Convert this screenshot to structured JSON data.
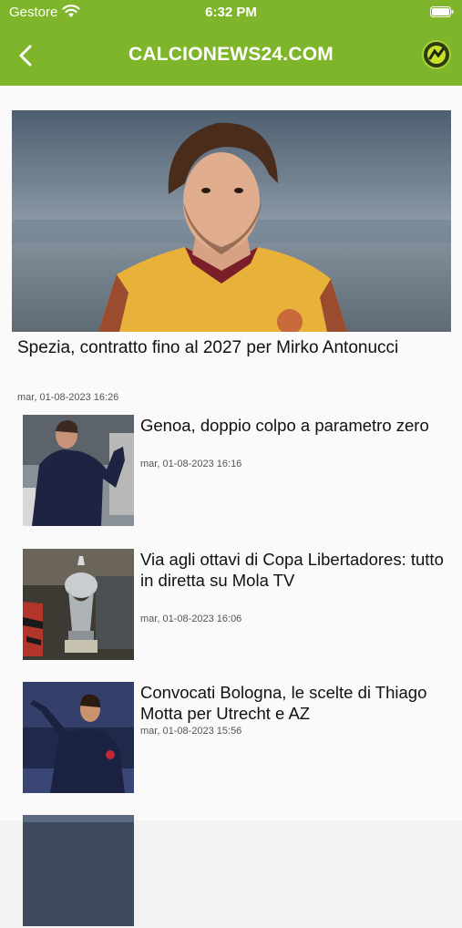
{
  "status_bar": {
    "carrier": "Gestore",
    "time": "6:32 PM"
  },
  "nav": {
    "title": "CALCIONEWS24.COM",
    "back_icon": "chevron-left-icon",
    "logo_icon": "site-logo-icon"
  },
  "colors": {
    "brand_green": "#7fb52a",
    "background": "#fafafa"
  },
  "hero": {
    "title": "Spezia, contratto fino al 2027 per Mirko Antonucci",
    "date": "mar, 01-08-2023 16:26"
  },
  "articles": [
    {
      "title": "Genoa, doppio colpo a parametro zero",
      "date": "mar, 01-08-2023 16:16"
    },
    {
      "title": "Via agli ottavi di Copa Libertadores: tutto in diretta su Mola TV",
      "date": "mar, 01-08-2023 16:06"
    },
    {
      "title": "Convocati Bologna, le scelte di Thiago Motta per Utrecht e AZ",
      "date": "mar, 01-08-2023 15:56"
    },
    {
      "title": "",
      "date": ""
    }
  ]
}
